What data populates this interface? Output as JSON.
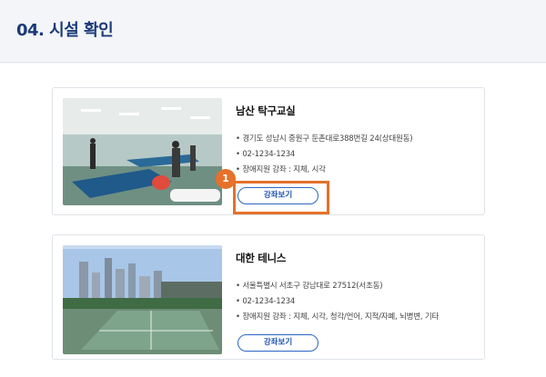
{
  "header": {
    "title": "04. 시설 확인"
  },
  "facilities": [
    {
      "name": "남산 탁구교실",
      "address": "• 경기도 성남시 중원구 둔촌대로388번길 24(상대원동)",
      "phone": "• 02-1234-1234",
      "support": "• 장애지원 강좌 : 지체, 시각",
      "button_label": "강좌보기",
      "image_icon": "table-tennis-photo"
    },
    {
      "name": "대한 테니스",
      "address": "• 서울특별시 서초구 강남대로 27512(서초동)",
      "phone": "• 02-1234-1234",
      "support": "• 장애지원 강좌 : 지체, 시각, 청각/언어, 지적/자폐, 뇌병변, 기타",
      "button_label": "강좌보기",
      "image_icon": "tennis-court-photo"
    }
  ],
  "annotation": {
    "step_number": "1",
    "color": "#e5712a"
  },
  "colors": {
    "title": "#1b3a78",
    "button_border": "#2b66c3",
    "accent": "#e5712a"
  }
}
